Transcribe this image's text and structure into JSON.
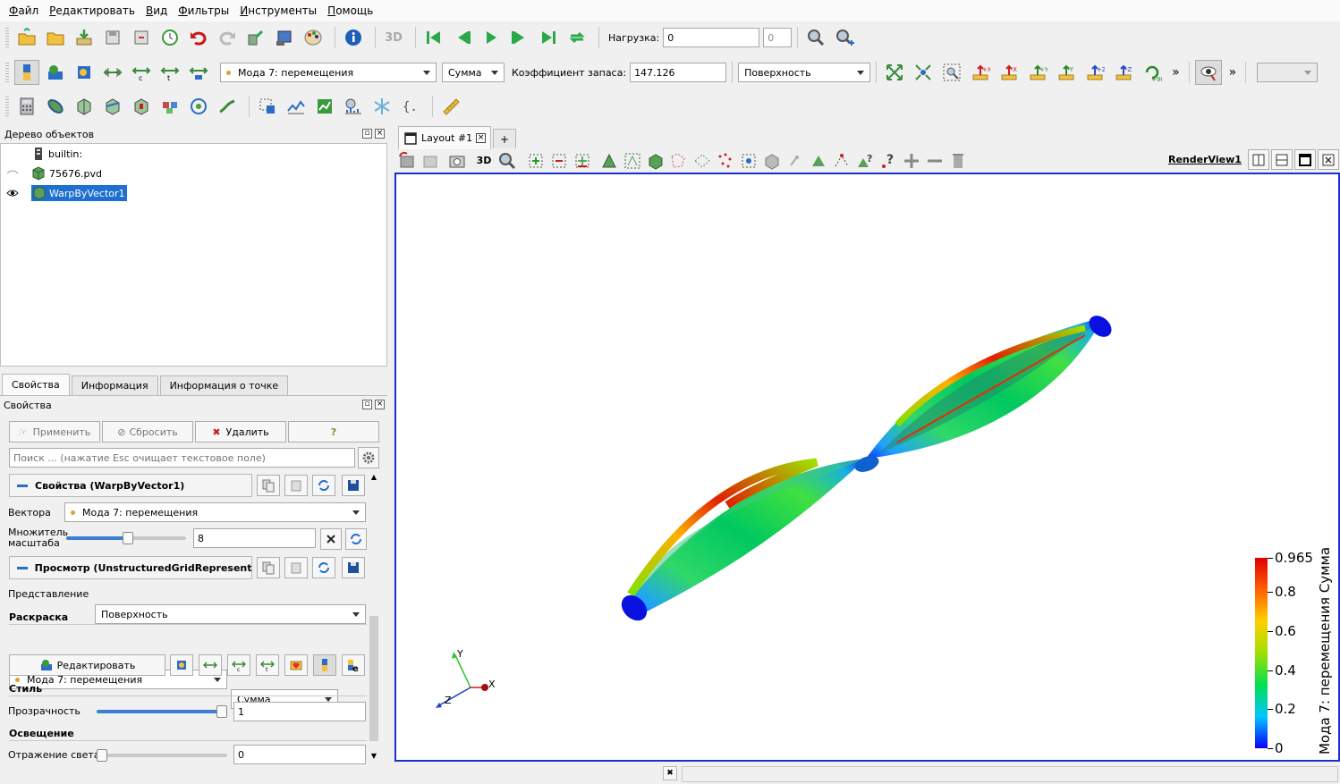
{
  "menu": [
    "Файл",
    "Редактировать",
    "Вид",
    "Фильтры",
    "Инструменты",
    "Помощь"
  ],
  "toolbar1": {
    "load_label": "Нагрузка:",
    "load_value": "0",
    "load_spin": "0"
  },
  "toolbar2": {
    "vectors_value": "Мода 7: перемещения",
    "component_value": "Сумма",
    "safety_label": "Коэффициент запаса:",
    "safety_value": "147.126",
    "representation_value": "Поверхность",
    "more": "»",
    "more2": "»"
  },
  "toolbar3_ruler": "",
  "tree": {
    "title": "Дерево объектов",
    "items": [
      {
        "label": "builtin:"
      },
      {
        "label": "75676.pvd"
      },
      {
        "label": "WarpByVector1"
      }
    ]
  },
  "prop_tabs": [
    "Свойства",
    "Информация",
    "Информация о точке"
  ],
  "properties": {
    "title": "Свойства",
    "apply": "Применить",
    "reset": "Сбросить",
    "delete": "Удалить",
    "help": "?",
    "search_placeholder": "Поиск ... (нажатие Esc очищает текстовое поле)",
    "section1": "Свойства (WarpByVector1)",
    "vectors_label": "Вектора",
    "vectors_value": "Мода 7: перемещения",
    "scale_label_1": "Множитель",
    "scale_label_2": "масштаба",
    "scale_value": "8",
    "scale_fraction": 0.52,
    "section2": "Просмотр (UnstructuredGridRepresenta",
    "representation_label": "Представление",
    "representation_value": "Поверхность",
    "coloring_label": "Раскраска",
    "coloring_value": "Мода 7: перемещения",
    "coloring_component": "Сумма",
    "edit_button": "Редактировать",
    "style_label": "Стиль",
    "opacity_label": "Прозрачность",
    "opacity_value": "1",
    "opacity_fraction": 1.0,
    "lighting_label": "Освещение",
    "specular_label": "Отражение света",
    "specular_value": "0"
  },
  "layout": {
    "tab_label": "Layout #1",
    "add_tab": "+",
    "view_name": "RenderView1",
    "btn_3d": "3D"
  },
  "axes": {
    "x": "X",
    "y": "Y",
    "z": "Z"
  },
  "colorbar": {
    "title": "Мода 7: перемещения Сумма",
    "ticks": [
      "0.965",
      "0.8",
      "0.6",
      "0.4",
      "0.2",
      "0"
    ],
    "colors": [
      "#0a00ff",
      "#00c8ff",
      "#00e050",
      "#a0e000",
      "#ffd000",
      "#ff6000",
      "#e00000"
    ]
  },
  "toolbar1_btn_3d": "3D"
}
